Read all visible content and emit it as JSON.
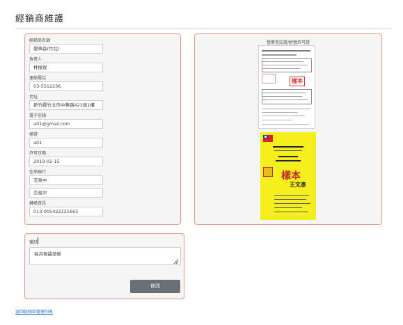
{
  "page": {
    "title": "經銷商維護",
    "back_link": "返回經銷商管理列表"
  },
  "form": {
    "fields": [
      {
        "label": "經銷商名稱",
        "value": "愛車森(竹北)"
      },
      {
        "label": "負責人",
        "value": "林振焜"
      },
      {
        "label": "連絡電話",
        "value": "03-5512236"
      },
      {
        "label": "地址",
        "value": "新竹縣竹北市中華路422號1樓"
      },
      {
        "label": "電子信箱",
        "value": "a01@gmail.com"
      },
      {
        "label": "帳號",
        "value": "a01"
      },
      {
        "label": "許可日期",
        "value": "2019-02-15"
      },
      {
        "label": "往來銀行",
        "value": "交易中"
      },
      {
        "label": "",
        "value": "交易中"
      },
      {
        "label": "轉帳資訊",
        "value": "013-005422221665"
      }
    ]
  },
  "documents": {
    "caption": "營業登記證/經營許可證",
    "stamp_text": "樣本",
    "cert_name": "王文彥"
  },
  "notes": {
    "label": "備註",
    "value": "每月根據結帳"
  },
  "actions": {
    "edit_label": "修改"
  }
}
